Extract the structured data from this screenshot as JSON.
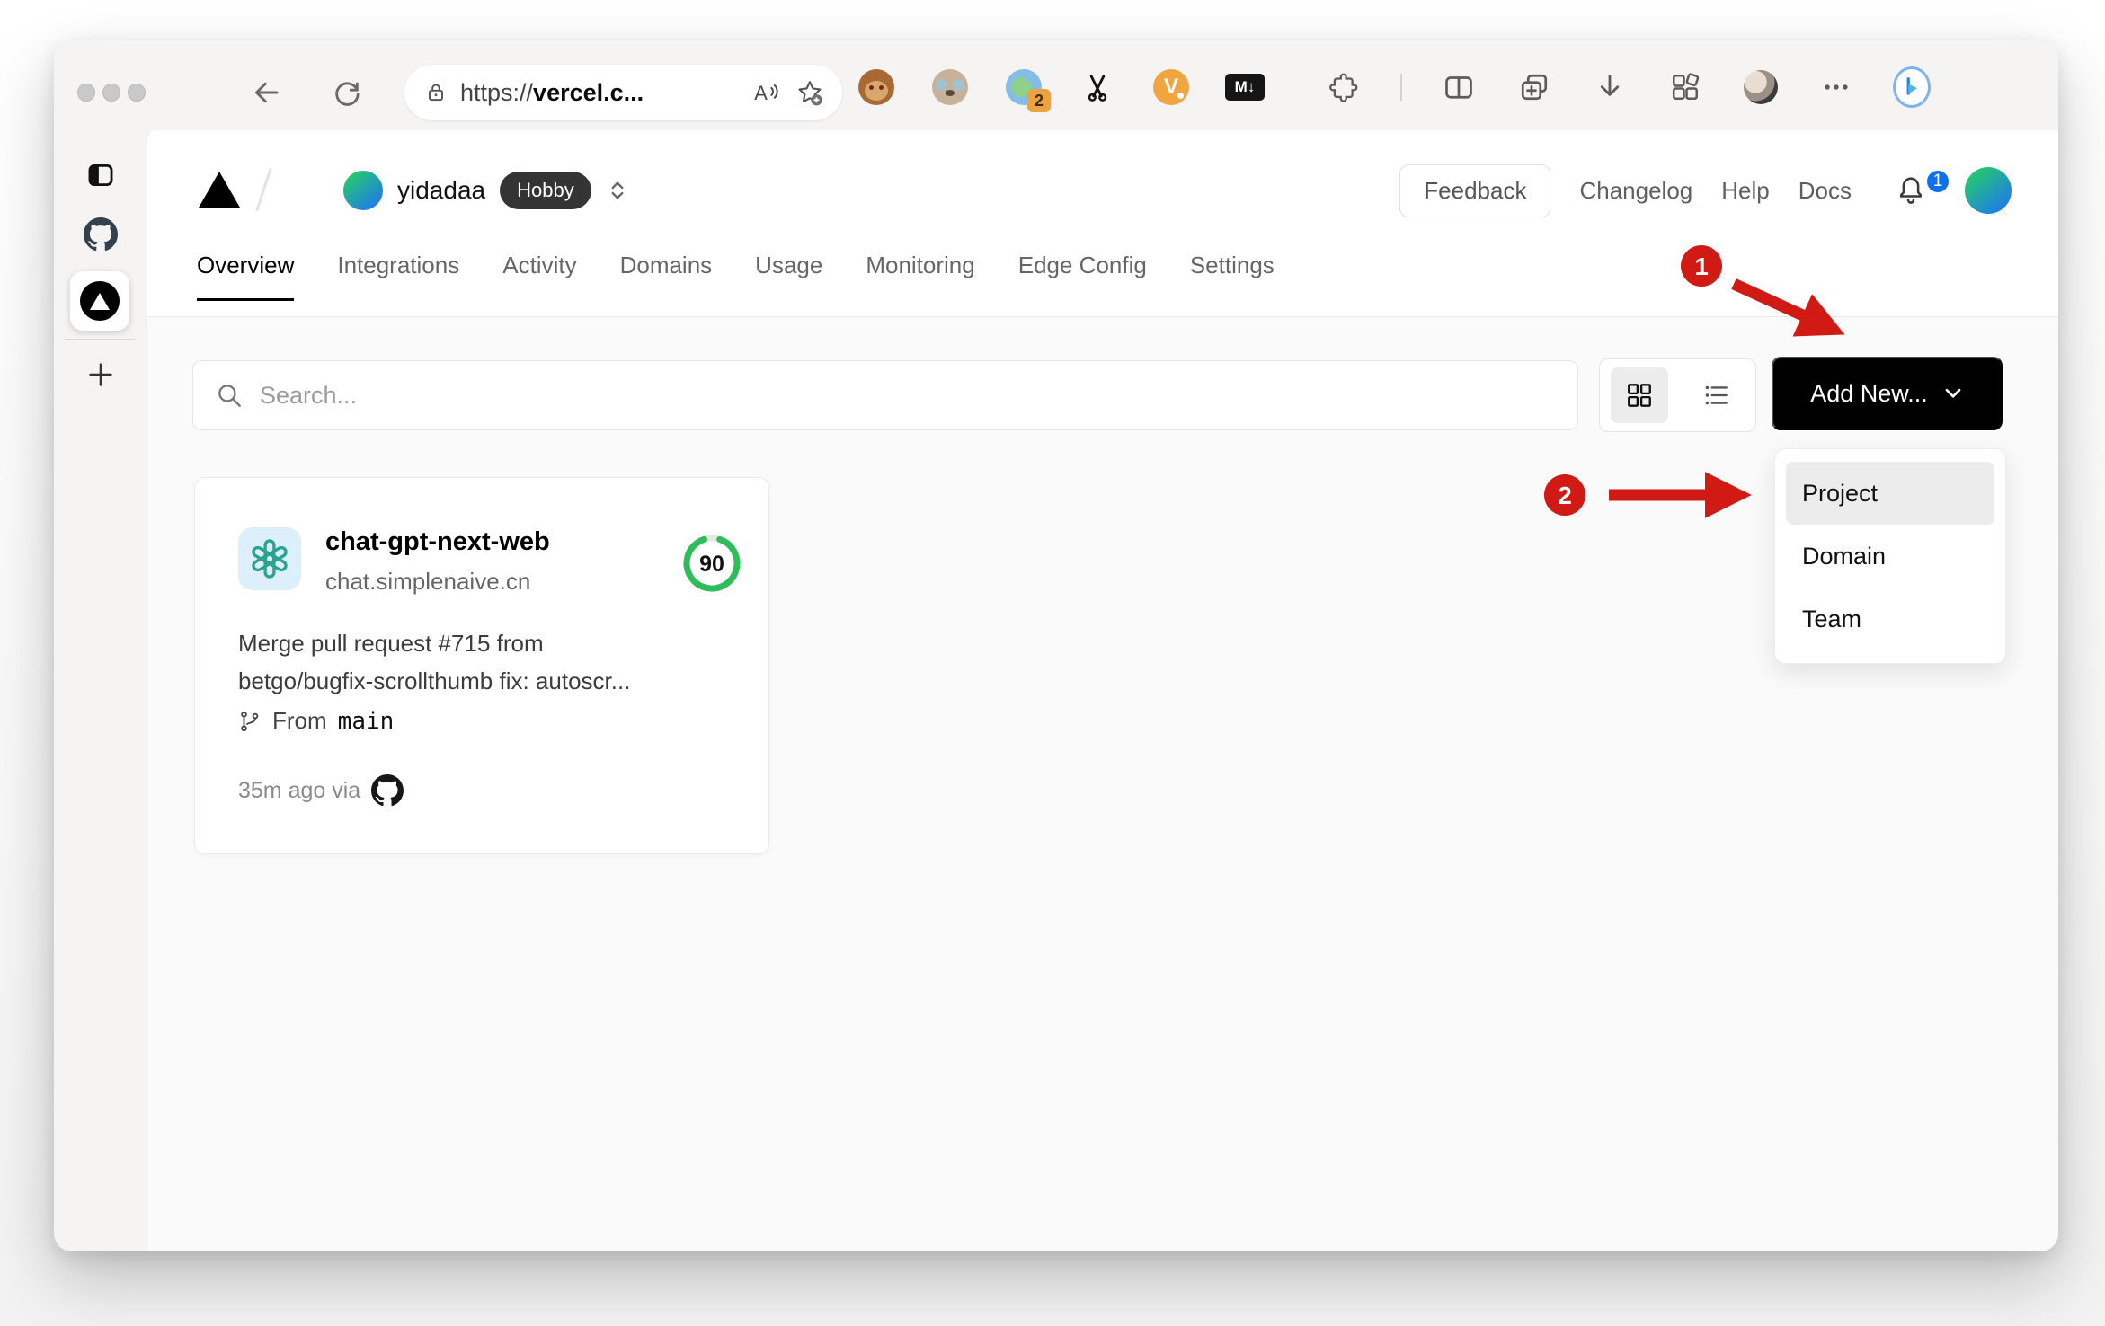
{
  "browser": {
    "url": {
      "scheme": "https://",
      "domain": "vercel.c..."
    },
    "extensions": {
      "badge_count": "2",
      "markdown_label": "M↓",
      "v_label": "V"
    }
  },
  "vercel": {
    "header": {
      "team_name": "yidadaa",
      "plan_badge": "Hobby",
      "feedback_label": "Feedback",
      "links": [
        {
          "label": "Changelog"
        },
        {
          "label": "Help"
        },
        {
          "label": "Docs"
        }
      ],
      "notification_count": "1"
    },
    "tabs": [
      {
        "label": "Overview",
        "active": true
      },
      {
        "label": "Integrations"
      },
      {
        "label": "Activity"
      },
      {
        "label": "Domains"
      },
      {
        "label": "Usage"
      },
      {
        "label": "Monitoring"
      },
      {
        "label": "Edge Config"
      },
      {
        "label": "Settings"
      }
    ],
    "toolbar": {
      "search_placeholder": "Search...",
      "add_new_label": "Add New..."
    },
    "add_new_menu": [
      {
        "label": "Project",
        "highlighted": true
      },
      {
        "label": "Domain"
      },
      {
        "label": "Team"
      }
    ],
    "project_card": {
      "name": "chat-gpt-next-web",
      "domain": "chat.simplenaive.cn",
      "score": "90",
      "commit_line1": "Merge pull request #715 from",
      "commit_line2": "betgo/bugfix-scrollthumb fix: autoscr...",
      "branch_label": "From",
      "branch_name": "main",
      "deploy_meta": "35m ago via"
    }
  },
  "annotations": {
    "step_1": "1",
    "step_2": "2"
  },
  "colors": {
    "annotation_red": "#d21a15",
    "score_green": "#2ebd59",
    "notification_blue": "#0b72ef",
    "button_black": "#000000"
  }
}
